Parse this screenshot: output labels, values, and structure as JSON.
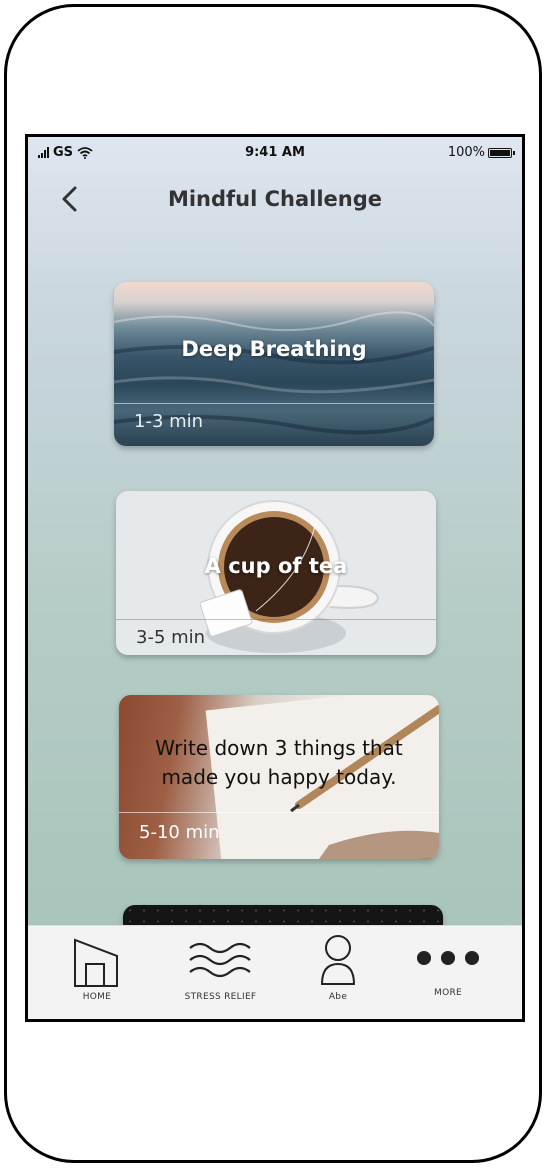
{
  "status": {
    "carrier": "GS",
    "time": "9:41 AM",
    "battery": "100%"
  },
  "header": {
    "title": "Mindful Challenge"
  },
  "cards": [
    {
      "title": "Deep Breathing",
      "duration": "1-3 min"
    },
    {
      "title": "A cup of tea",
      "duration": "3-5 min"
    },
    {
      "title_line1": "Write down 3 things that",
      "title_line2": "made you happy today.",
      "duration": "5-10 min"
    }
  ],
  "tabs": [
    {
      "label": "HOME",
      "icon": "home-icon"
    },
    {
      "label": "STRESS RELIEF",
      "icon": "waves-icon"
    },
    {
      "label": "Abe",
      "icon": "user-icon"
    },
    {
      "label": "MORE",
      "icon": "more-dots-icon"
    }
  ]
}
